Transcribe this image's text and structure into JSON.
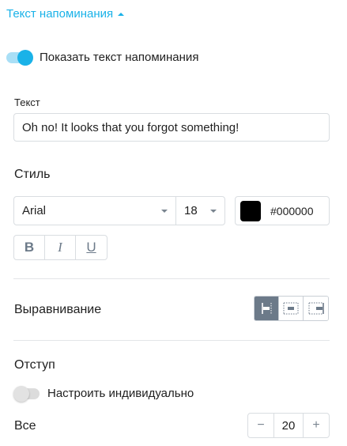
{
  "section": {
    "title": "Текст напоминания"
  },
  "show_text_toggle": {
    "label": "Показать текст напоминания",
    "checked": true
  },
  "text_field": {
    "label": "Текст",
    "value": "Oh no! It looks that you forgot something!"
  },
  "style": {
    "title": "Стиль",
    "font_family": "Arial",
    "font_size": "18",
    "color_hex": "#000000",
    "color_value": "#000000",
    "format_buttons": {
      "bold": "B",
      "italic": "I",
      "underline": "U"
    }
  },
  "alignment": {
    "title": "Выравнивание",
    "selected": "left"
  },
  "padding": {
    "title": "Отступ",
    "custom_toggle": {
      "label": "Настроить индивидуально",
      "checked": false
    },
    "all": {
      "label": "Все",
      "value": "20",
      "minus": "−",
      "plus": "+"
    }
  },
  "colors": {
    "accent": "#1ab2e8",
    "active_align": "#6c7a89"
  }
}
